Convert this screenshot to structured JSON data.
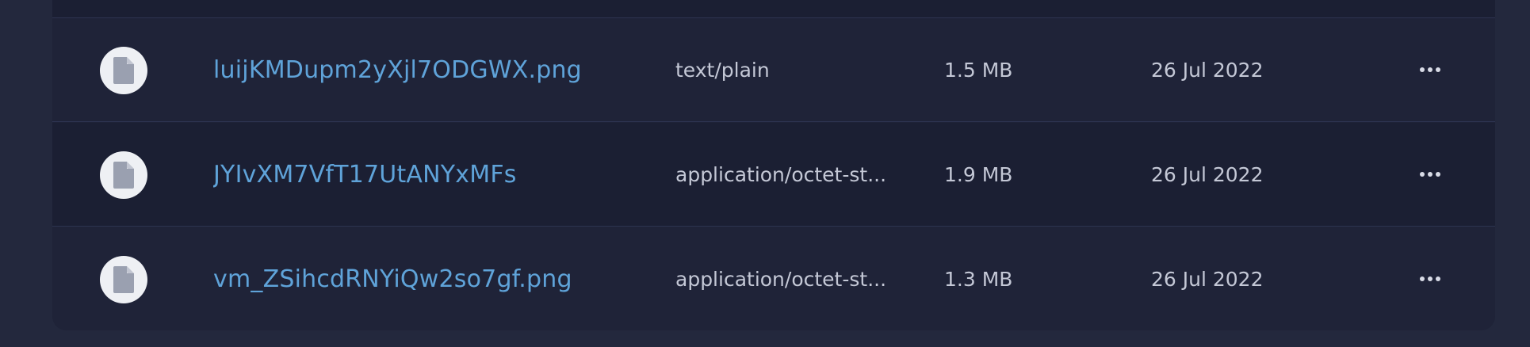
{
  "files": [
    {
      "name": "luijKMDupm2yXjl7ODGWX.png",
      "type": "text/plain",
      "size": "1.5 MB",
      "date": "26 Jul 2022",
      "icon": "document-icon",
      "action_icon": "more-horizontal-icon"
    },
    {
      "name": "JYIvXM7VfT17UtANYxMFs",
      "type": "application/octet-st...",
      "size": "1.9 MB",
      "date": "26 Jul 2022",
      "icon": "document-icon",
      "action_icon": "more-horizontal-icon"
    },
    {
      "name": "vm_ZSihcdRNYiQw2so7gf.png",
      "type": "application/octet-st...",
      "size": "1.3 MB",
      "date": "26 Jul 2022",
      "icon": "document-icon",
      "action_icon": "more-horizontal-icon"
    }
  ],
  "colors": {
    "background": "#23283d",
    "panel": "#1f2338",
    "panel_alt": "#1b1f33",
    "link": "#5fa3d9",
    "text": "#c4c8d6",
    "icon_bg": "#eef0f4",
    "icon_fg": "#9aa0b0"
  }
}
